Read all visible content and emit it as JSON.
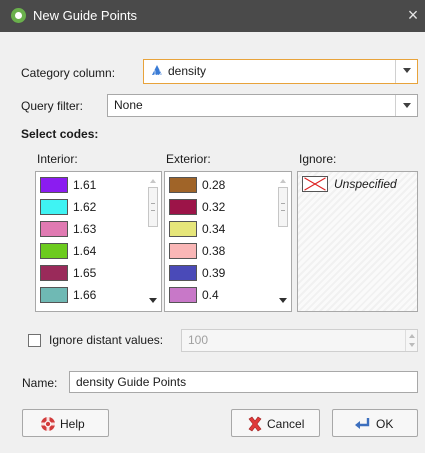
{
  "window": {
    "title": "New Guide Points",
    "close_glyph": "×",
    "app_icon": "leapfrog-app-icon"
  },
  "category": {
    "label": "Category column:",
    "value": "density",
    "icon": "numeric-column-icon"
  },
  "query": {
    "label": "Query filter:",
    "value": "None"
  },
  "select_codes": {
    "heading": "Select codes:"
  },
  "interior": {
    "label": "Interior:",
    "items": [
      {
        "text": "1.61",
        "color": "#8b1cf0"
      },
      {
        "text": "1.62",
        "color": "#3ff3f3"
      },
      {
        "text": "1.63",
        "color": "#e07ab2"
      },
      {
        "text": "1.64",
        "color": "#6ccb1e"
      },
      {
        "text": "1.65",
        "color": "#9a2a5a"
      },
      {
        "text": "1.66",
        "color": "#6fb9b4"
      }
    ]
  },
  "exterior": {
    "label": "Exterior:",
    "items": [
      {
        "text": "0.28",
        "color": "#a06428"
      },
      {
        "text": "0.32",
        "color": "#9c1448"
      },
      {
        "text": "0.34",
        "color": "#e6e67a"
      },
      {
        "text": "0.38",
        "color": "#f9b6b6"
      },
      {
        "text": "0.39",
        "color": "#4a4ab8"
      },
      {
        "text": "0.4",
        "color": "#c878c8"
      }
    ]
  },
  "ignore": {
    "label": "Ignore:",
    "items": [
      {
        "text": "Unspecified",
        "icon": "unspecified-x-icon"
      }
    ]
  },
  "distant": {
    "label": "Ignore distant values:",
    "checked": false,
    "value": "100"
  },
  "name": {
    "label": "Name:",
    "value": "density Guide Points"
  },
  "buttons": {
    "help": "Help",
    "cancel": "Cancel",
    "ok": "OK"
  }
}
